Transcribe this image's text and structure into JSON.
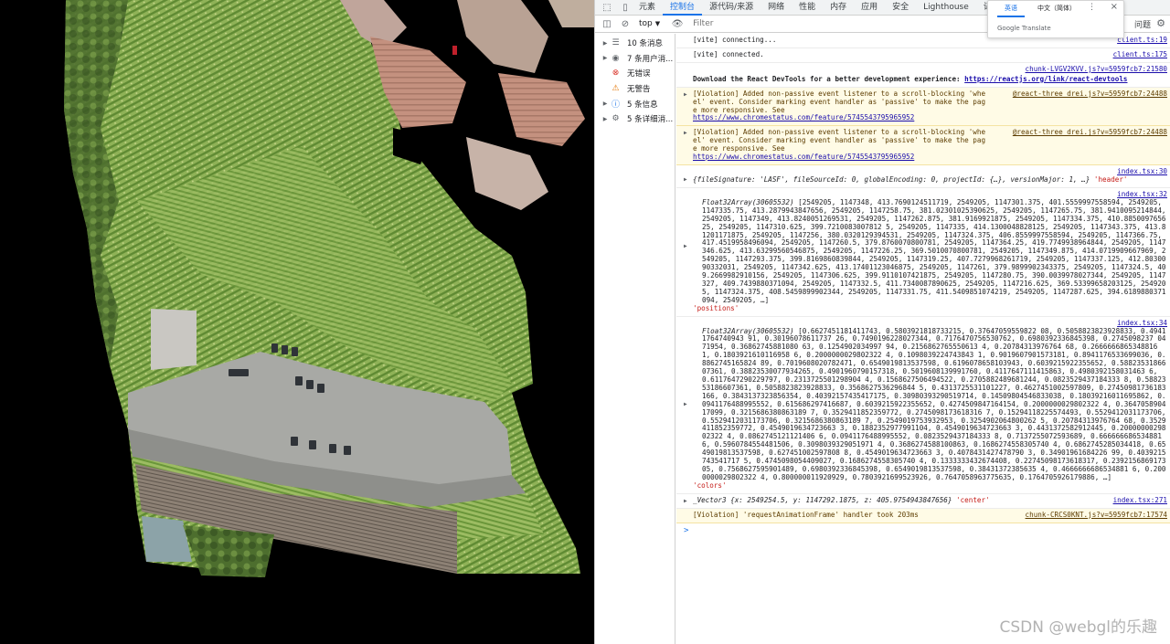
{
  "tabs": [
    "元素",
    "控制台",
    "源代码/来源",
    "网络",
    "性能",
    "内存",
    "应用",
    "安全",
    "Lighthouse",
    "记"
  ],
  "active_tab": "控制台",
  "toolbar": {
    "context": "top",
    "filter_placeholder": "Filter",
    "issues_label": "问题"
  },
  "sidebar": [
    {
      "label": "10 条消息",
      "icon": "list-icon"
    },
    {
      "label": "7 条用户消...",
      "icon": "user-icon"
    },
    {
      "label": "无错误",
      "icon": "error-icon"
    },
    {
      "label": "无警告",
      "icon": "warning-icon"
    },
    {
      "label": "5 条信息",
      "icon": "info-icon"
    },
    {
      "label": "5 条详细消...",
      "icon": "bug-icon"
    }
  ],
  "console": {
    "m1": {
      "text": "[vite] connecting...",
      "src": "client.ts:19"
    },
    "m2": {
      "text": "[vite] connected.",
      "src": "client.ts:175"
    },
    "m3": {
      "src": "chunk-LVGV2KVV.js?v=5959fcb7:21580",
      "text": "Download the React DevTools for a better development experience: ",
      "link": "https://reactjs.org/link/react-devtools"
    },
    "m4": {
      "text": "[Violation] Added non-passive event listener to a scroll-blocking 'wheel' event. Consider marking event handler as 'passive' to make the page more responsive. See ",
      "link": "https://www.chromestatus.com/feature/5745543795965952",
      "src": "@react-three_drei.js?v=5959fcb7:24488"
    },
    "m5": {
      "text": "[Violation] Added non-passive event listener to a scroll-blocking 'wheel' event. Consider marking event handler as 'passive' to make the page more responsive. See ",
      "link": "https://www.chromestatus.com/feature/5745543795965952",
      "src": "@react-three_drei.js?v=5959fcb7:24488"
    },
    "m6": {
      "src": "index.tsx:30",
      "text": "{fileSignature: 'LASF', fileSourceId: 0, globalEncoding: 0, projectId: {…}, versionMajor: 1, …}",
      "tag": "'header'"
    },
    "m7": {
      "src": "index.tsx:32",
      "head": "Float32Array(30605532)",
      "body": "[2549205, 1147348, 413.7690124511719, 2549205, 1147301.375, 401.5559997558594, 2549205, 1147335.75, 413.2879943847656, 2549205, 1147258.75, 381.02301025390625, 2549205, 1147265.75, 381.9410095214844, 2549205, 1147349, 413.8240051269531, 2549205, 1147262.875, 381.9169921875, 2549205, 1147334.375, 410.885009765625, 2549205, 1147310.625, 399.7210083007812 5, 2549205, 1147335, 414.1300048828125, 2549205, 1147343.375, 413.81201171875, 2549205, 1147256, 380.0320129394531, 2549205, 1147324.375, 406.8559997558594, 2549205, 1147366.75, 417.4519958496094, 2549205, 1147260.5, 379.8760070800781, 2549205, 1147364.25, 419.7749938964844, 2549205, 1147346.625, 413.63299560546875, 2549205, 1147226.25, 369.5010070800781, 2549205, 1147349.875, 414.0719909667969, 2549205, 1147293.375, 399.8169860839844, 2549205, 1147319.25, 407.7279968261719, 2549205, 1147337.125, 412.8030090332031, 2549205, 1147342.625, 413.17401123046875, 2549205, 1147261, 379.9899902343375, 2549205, 1147324.5, 409.2669982910156, 2549205, 1147306.625, 399.9110107421875, 2549205, 1147280.75, 390.0039978027344, 2549205, 1147327, 409.7439880371094, 2549205, 1147332.5, 411.7340087890625, 2549205, 1147216.625, 369.53399658203125, 2549205, 1147324.375, 408.5459899902344, 2549205, 1147331.75, 411.5409851074219, 2549205, 1147287.625, 394.6189880371094, 2549205, …]",
      "tag": "'positions'"
    },
    "m8": {
      "src": "index.tsx:34",
      "head": "Float32Array(30605532)",
      "body": "[0.6627451181411743, 0.5803921818733215, 0.37647059559822 08, 0.5058823823928833, 0.49411764740943 91, 0.30196078611737 26, 0.7490196228027344, 0.7176470756530762, 0.6980392336845398, 0.2745098237 0471954, 0.36862745881080 63, 0.1254902034997 94, 0.2156862765550613 4, 0.20784313976764 68, 0.2666666865348816 1, 0.1803921610116958 6, 0.2000000029802322 4, 0.1098039224743843 1, 0.9019607901573181, 0.8941176533699036, 0.8862745165824 89, 0.7019608020782471, 0.6549019813537598, 0.6196078658103943, 0.6039215922355652, 0.5882353186607361, 0.38823530077934265, 0.4901960790157318, 0.5019608139991760, 0.4117647111415863, 0.4980392158031463 6, 0.6117647290229797, 0.2313725501298904 4, 0.1568627506494522, 0.2705882489681244, 0.0823529437184333 8, 0.5882353186607361, 0.5058823823928833, 0.3568627536296844 5, 0.4313725531101227, 0.4627451002597809, 0.27450981736183166, 0.3843137323856354, 0.40392157435417175, 0.30980393290519714, 0.14509804546833038, 0.18039216011695862, 0.0941176488995552, 0.615686297416687, 0.6039215922355652, 0.4274509847164154, 0.2000000029802322 4, 0.364705890417099, 0.3215686380863189 7, 0.3529411852359772, 0.2745098173618316 7, 0.15294118225574493, 0.5529412031173706, 0.5529412031173706, 0.3215686380863189 7, 0.2549019753932953, 0.3254902064800262 5, 0.20784313976764 68, 0.3529411852359772, 0.4549019634723663 3, 0.1882352977991104, 0.4549019634723663 3, 0.4431372582912445, 0.2000000029802322 4, 0.0862745121121406 6, 0.0941176488995552, 0.0823529437184333 8, 0.7137255072593689, 0.6666666865348816, 0.5960784554481506, 0.3098039329051971 4, 0.3686274588100863, 0.1686274558305740 4, 0.6862745285034418, 0.6549019813537598, 0.627451002597808 8, 0.4549019634723663 3, 0.4078431427478790 3, 0.34901961684226 99, 0.4039215743541717 5, 0.4745098054409027, 0.1686274558305740 4, 0.1333333432674408, 0.22745098173618317, 0.239215686917305, 0.7568627595901489, 0.6980392336845398, 0.6549019813537598, 0.38431372385635 4, 0.4666666686534881 6, 0.2000000029802322 4, 0.800000011920929, 0.7803921699523926, 0.7647058963775635, 0.1764705926179886, …]",
      "tag": "'colors'"
    },
    "m9": {
      "src": "index.tsx:271",
      "text": "_Vector3 {x: 2549254.5, y: 1147292.1875, z: 405.9754943847656}",
      "tag": "'center'"
    },
    "m10": {
      "text": "[Violation] 'requestAnimationFrame' handler took 203ms",
      "src": "chunk-CRCS0KNT.js?v=5959fcb7:17574"
    },
    "prompt": ">"
  },
  "translate_popup": {
    "lang_en": "英语",
    "lang_zh": "中文（简体）",
    "brand": "Google Translate"
  },
  "watermark": "CSDN @webgl的乐趣",
  "colors": {
    "accent": "#1a73e8",
    "warn_bg": "#fffbe6",
    "link": "#1a0dab",
    "string": "#c41a16"
  }
}
